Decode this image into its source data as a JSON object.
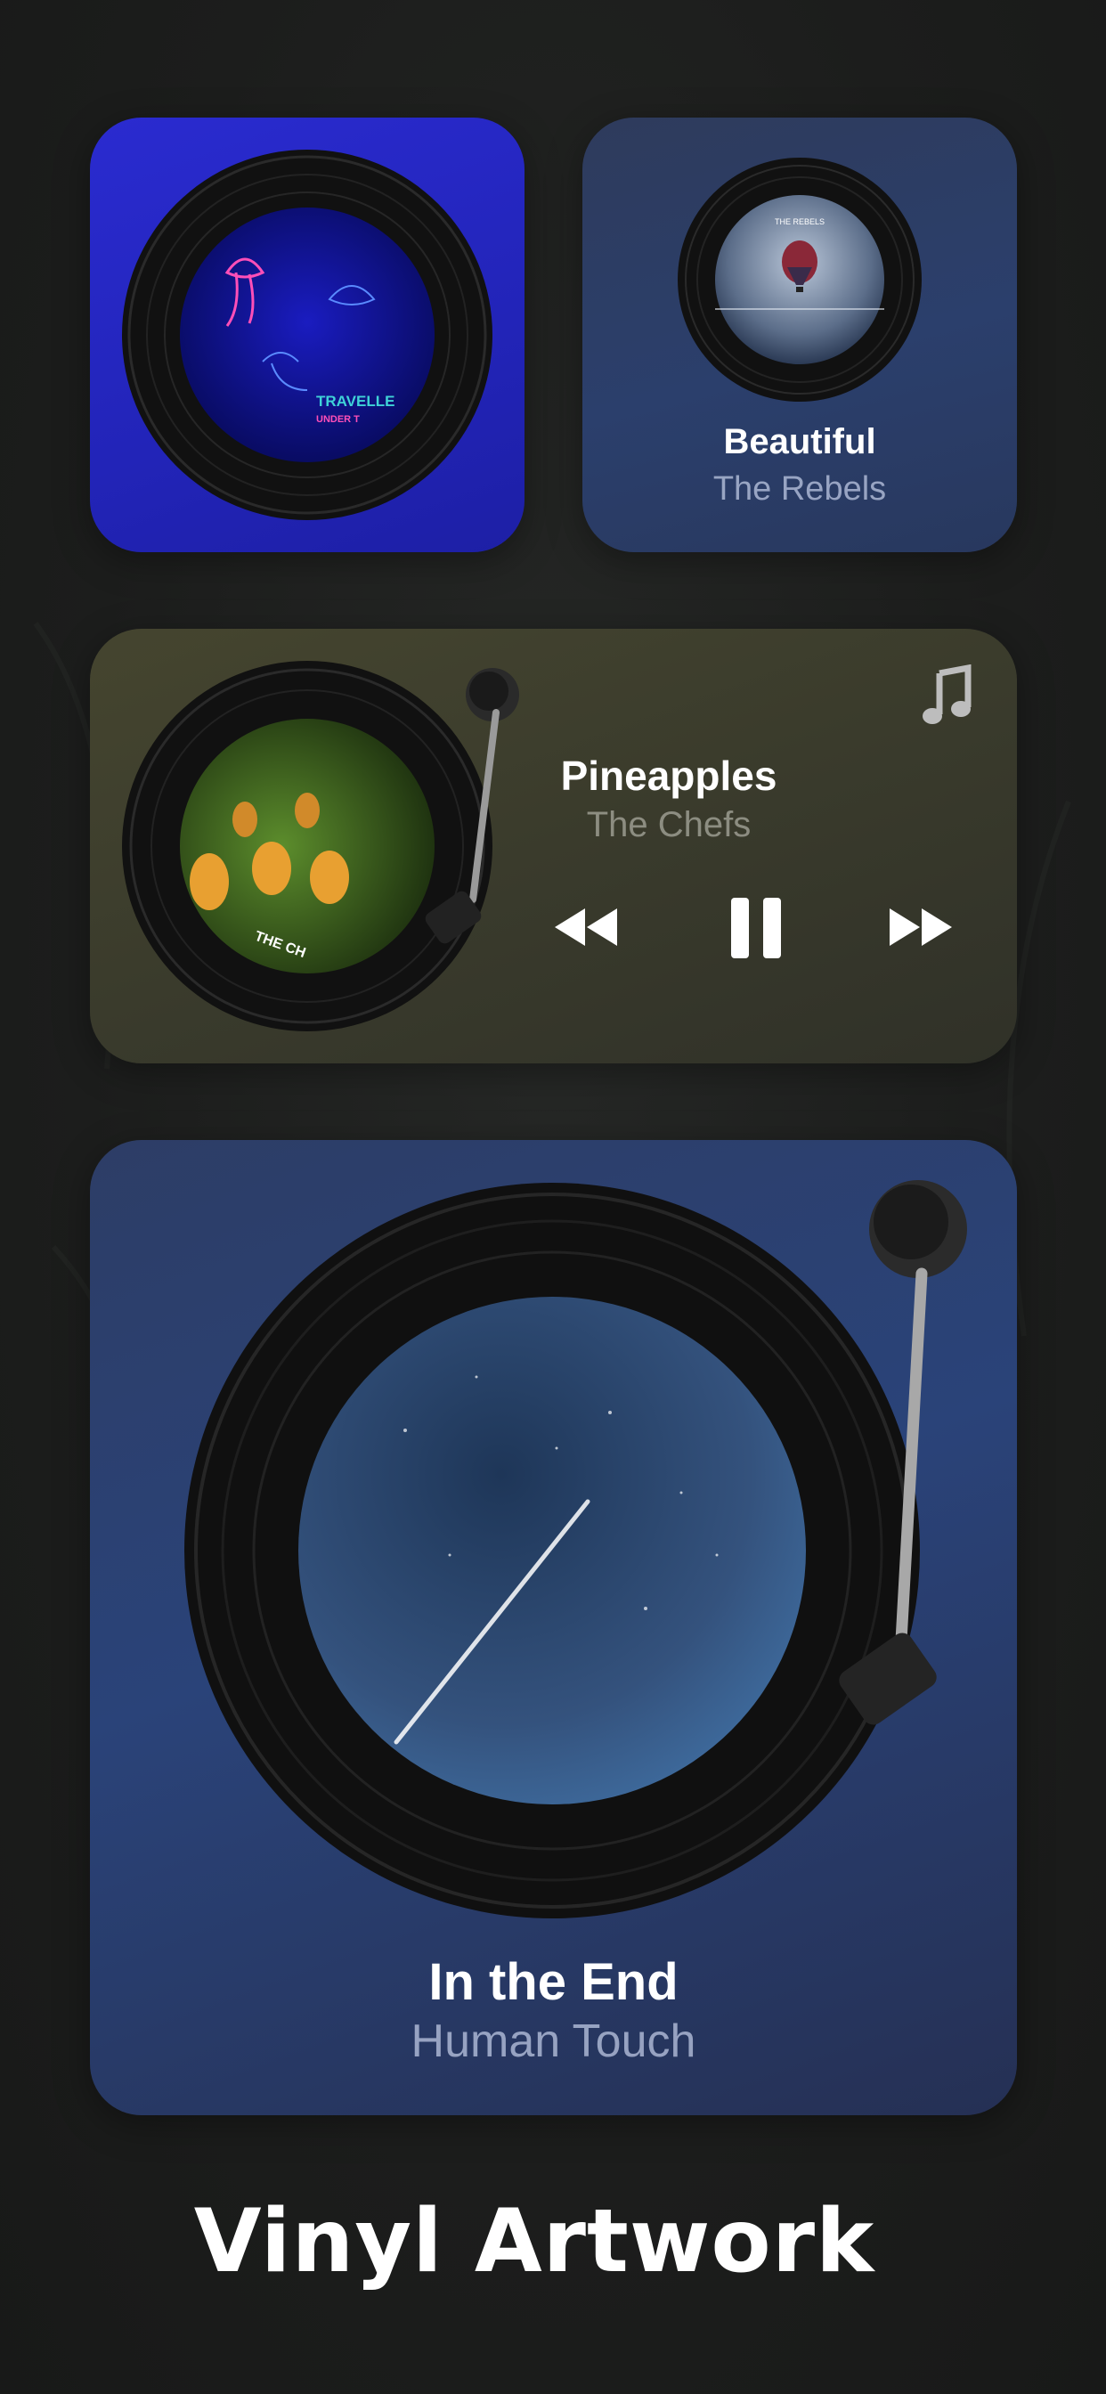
{
  "widgets": {
    "small_1": {
      "album_label_line1": "TRAVELLE",
      "album_label_line2": "UNDER T"
    },
    "small_2": {
      "song": "Beautiful",
      "artist": "The Rebels",
      "album_label": "THE REBELS"
    },
    "medium": {
      "song": "Pineapples",
      "artist": "The Chefs",
      "album_label": "THE CH"
    },
    "large": {
      "song": "In the End",
      "artist": "Human Touch"
    }
  },
  "controls": {
    "previous_icon": "rewind-icon",
    "pause_icon": "pause-icon",
    "next_icon": "fast-forward-icon",
    "music_icon": "music-note-icon"
  },
  "footer": {
    "title": "Vinyl Artwork"
  },
  "colors": {
    "accent_blue": "#2224b8",
    "card_gray_blue": "#2b3f6c",
    "card_olive": "#3a3b2c",
    "card_navy": "#2a4379"
  }
}
